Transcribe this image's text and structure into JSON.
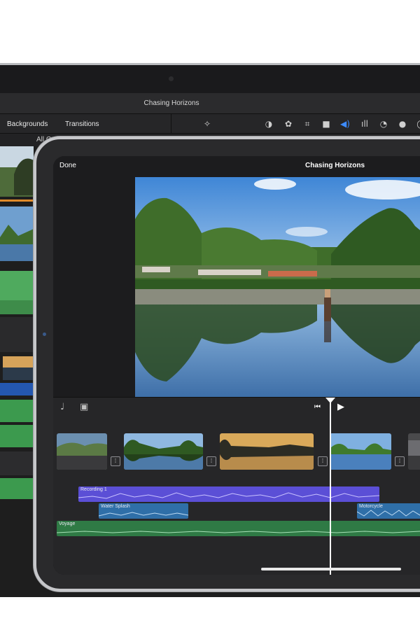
{
  "mac": {
    "title": "Chasing Horizons",
    "tabs": [
      "Backgrounds",
      "Transitions"
    ],
    "filter_label": "All C",
    "toolbar_icons": [
      "magic-wand-icon",
      "color-balance-icon",
      "palette-icon",
      "crop-icon",
      "camera-icon",
      "volume-icon",
      "equalizer-icon",
      "speed-icon",
      "filter-icon",
      "info-icon"
    ]
  },
  "ipad": {
    "done_label": "Done",
    "title": "Chasing Horizons",
    "timeline": {
      "audio_tracks": [
        {
          "label": "Recording 1",
          "color": "#5b4fd6"
        },
        {
          "label": "Water Splash",
          "color": "#2f6fa8"
        },
        {
          "label": "Motorcycle",
          "color": "#2f6fa8"
        },
        {
          "label": "Voyage",
          "color": "#2f7a45"
        }
      ]
    }
  },
  "colors": {
    "accent": "#3d8bff",
    "recording": "#5b4fd6",
    "sfx": "#2f6fa8",
    "music": "#2f7a45"
  }
}
